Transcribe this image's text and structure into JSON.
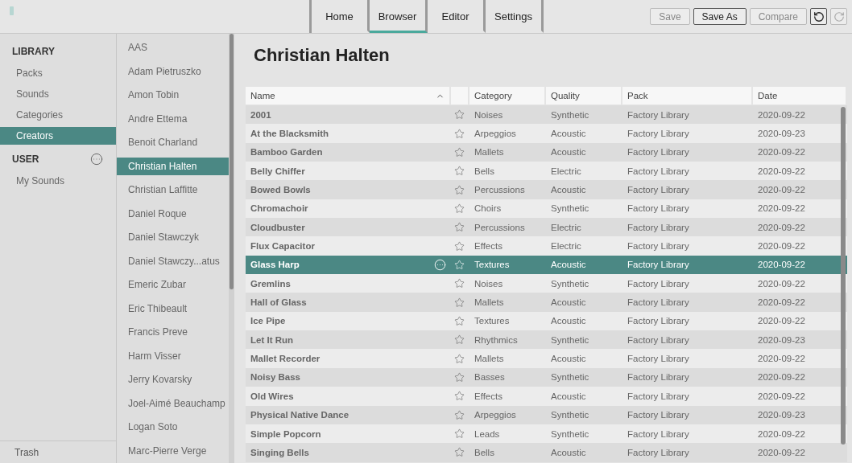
{
  "toolbar": {
    "tabs": [
      {
        "label": "Home",
        "selected": false
      },
      {
        "label": "Browser",
        "selected": true
      },
      {
        "label": "Editor",
        "selected": false
      },
      {
        "label": "Settings",
        "selected": false
      }
    ],
    "buttons": [
      {
        "label": "Save",
        "disabled": true
      },
      {
        "label": "Save As",
        "disabled": false
      },
      {
        "label": "Compare",
        "disabled": true
      }
    ],
    "undo": {
      "disabled": false
    },
    "redo": {
      "disabled": true
    }
  },
  "sidebar": {
    "sections": [
      {
        "title": "LIBRARY",
        "has_menu": false,
        "items": [
          {
            "label": "Packs",
            "selected": false
          },
          {
            "label": "Sounds",
            "selected": false
          },
          {
            "label": "Categories",
            "selected": false
          },
          {
            "label": "Creators",
            "selected": true
          }
        ]
      },
      {
        "title": "USER",
        "has_menu": true,
        "items": [
          {
            "label": "My Sounds",
            "selected": false
          }
        ]
      }
    ],
    "footer": "Trash"
  },
  "creators": [
    {
      "name": "AAS",
      "selected": false
    },
    {
      "name": "Adam Pietruszko",
      "selected": false
    },
    {
      "name": "Amon Tobin",
      "selected": false
    },
    {
      "name": "Andre Ettema",
      "selected": false
    },
    {
      "name": "Benoit Charland",
      "selected": false
    },
    {
      "name": "Christian Halten",
      "selected": true
    },
    {
      "name": "Christian Laffitte",
      "selected": false
    },
    {
      "name": "Daniel Roque",
      "selected": false
    },
    {
      "name": "Daniel Stawczyk",
      "selected": false
    },
    {
      "name": "Daniel Stawczy...atus",
      "selected": false
    },
    {
      "name": "Emeric Zubar",
      "selected": false
    },
    {
      "name": "Eric Thibeault",
      "selected": false
    },
    {
      "name": "Francis Preve",
      "selected": false
    },
    {
      "name": "Harm Visser",
      "selected": false
    },
    {
      "name": "Jerry Kovarsky",
      "selected": false
    },
    {
      "name": "Joel-Aimé Beauchamp",
      "selected": false
    },
    {
      "name": "Logan Soto",
      "selected": false
    },
    {
      "name": "Marc-Pierre Verge",
      "selected": false
    }
  ],
  "heading": "Christian Halten",
  "table": {
    "columns": [
      "Name",
      "",
      "Category",
      "Quality",
      "Pack",
      "Date"
    ],
    "rows": [
      {
        "name": "2001",
        "favorite": false,
        "category": "Noises",
        "quality": "Synthetic",
        "pack": "Factory Library",
        "date": "2020-09-22",
        "selected": false
      },
      {
        "name": "At the Blacksmith",
        "favorite": false,
        "category": "Arpeggios",
        "quality": "Acoustic",
        "pack": "Factory Library",
        "date": "2020-09-23",
        "selected": false
      },
      {
        "name": "Bamboo Garden",
        "favorite": false,
        "category": "Mallets",
        "quality": "Acoustic",
        "pack": "Factory Library",
        "date": "2020-09-22",
        "selected": false
      },
      {
        "name": "Belly Chiffer",
        "favorite": false,
        "category": "Bells",
        "quality": "Electric",
        "pack": "Factory Library",
        "date": "2020-09-22",
        "selected": false
      },
      {
        "name": "Bowed Bowls",
        "favorite": false,
        "category": "Percussions",
        "quality": "Acoustic",
        "pack": "Factory Library",
        "date": "2020-09-22",
        "selected": false
      },
      {
        "name": "Chromachoir",
        "favorite": false,
        "category": "Choirs",
        "quality": "Synthetic",
        "pack": "Factory Library",
        "date": "2020-09-22",
        "selected": false
      },
      {
        "name": "Cloudbuster",
        "favorite": false,
        "category": "Percussions",
        "quality": "Electric",
        "pack": "Factory Library",
        "date": "2020-09-22",
        "selected": false
      },
      {
        "name": "Flux Capacitor",
        "favorite": false,
        "category": "Effects",
        "quality": "Electric",
        "pack": "Factory Library",
        "date": "2020-09-22",
        "selected": false
      },
      {
        "name": "Glass Harp",
        "favorite": false,
        "category": "Textures",
        "quality": "Acoustic",
        "pack": "Factory Library",
        "date": "2020-09-22",
        "selected": true
      },
      {
        "name": "Gremlins",
        "favorite": false,
        "category": "Noises",
        "quality": "Synthetic",
        "pack": "Factory Library",
        "date": "2020-09-22",
        "selected": false
      },
      {
        "name": "Hall of Glass",
        "favorite": false,
        "category": "Mallets",
        "quality": "Acoustic",
        "pack": "Factory Library",
        "date": "2020-09-22",
        "selected": false
      },
      {
        "name": "Ice Pipe",
        "favorite": false,
        "category": "Textures",
        "quality": "Acoustic",
        "pack": "Factory Library",
        "date": "2020-09-22",
        "selected": false
      },
      {
        "name": "Let It Run",
        "favorite": false,
        "category": "Rhythmics",
        "quality": "Synthetic",
        "pack": "Factory Library",
        "date": "2020-09-23",
        "selected": false
      },
      {
        "name": "Mallet Recorder",
        "favorite": false,
        "category": "Mallets",
        "quality": "Acoustic",
        "pack": "Factory Library",
        "date": "2020-09-22",
        "selected": false
      },
      {
        "name": "Noisy Bass",
        "favorite": false,
        "category": "Basses",
        "quality": "Synthetic",
        "pack": "Factory Library",
        "date": "2020-09-22",
        "selected": false
      },
      {
        "name": "Old Wires",
        "favorite": false,
        "category": "Effects",
        "quality": "Acoustic",
        "pack": "Factory Library",
        "date": "2020-09-22",
        "selected": false
      },
      {
        "name": "Physical Native Dance",
        "favorite": false,
        "category": "Arpeggios",
        "quality": "Synthetic",
        "pack": "Factory Library",
        "date": "2020-09-23",
        "selected": false
      },
      {
        "name": "Simple Popcorn",
        "favorite": false,
        "category": "Leads",
        "quality": "Synthetic",
        "pack": "Factory Library",
        "date": "2020-09-22",
        "selected": false
      },
      {
        "name": "Singing Bells",
        "favorite": false,
        "category": "Bells",
        "quality": "Acoustic",
        "pack": "Factory Library",
        "date": "2020-09-22",
        "selected": false
      }
    ]
  }
}
